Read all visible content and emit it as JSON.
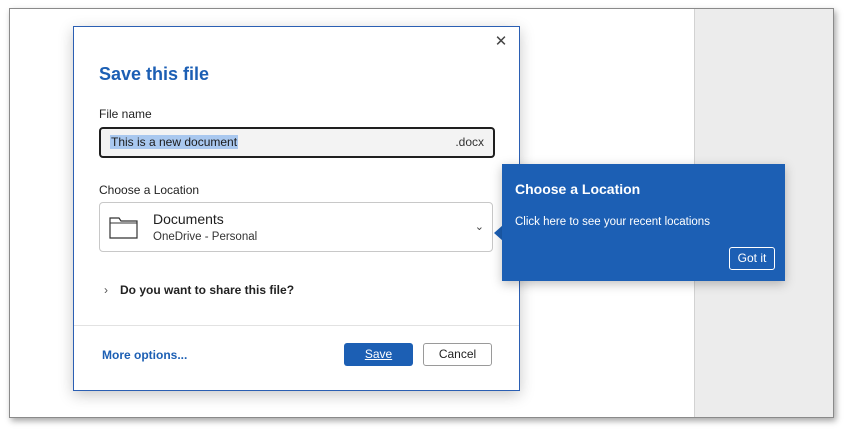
{
  "dialog": {
    "title": "Save this file",
    "close_icon": "close-icon",
    "file_name_label": "File name",
    "file_name_value": "This is a new document",
    "file_extension": ".docx",
    "location_label": "Choose a Location",
    "location": {
      "name": "Documents",
      "sub": "OneDrive - Personal",
      "icon": "folder-icon",
      "dropdown_icon": "chevron-down-icon"
    },
    "share_label": "Do you want to share this file?",
    "share_icon": "chevron-right-icon",
    "more_options": "More options...",
    "save_label": "Save",
    "cancel_label": "Cancel"
  },
  "callout": {
    "title": "Choose a Location",
    "body": "Click here to see your recent locations",
    "button": "Got it"
  },
  "colors": {
    "accent": "#1c5fb4",
    "selection": "#a9c8ef"
  }
}
